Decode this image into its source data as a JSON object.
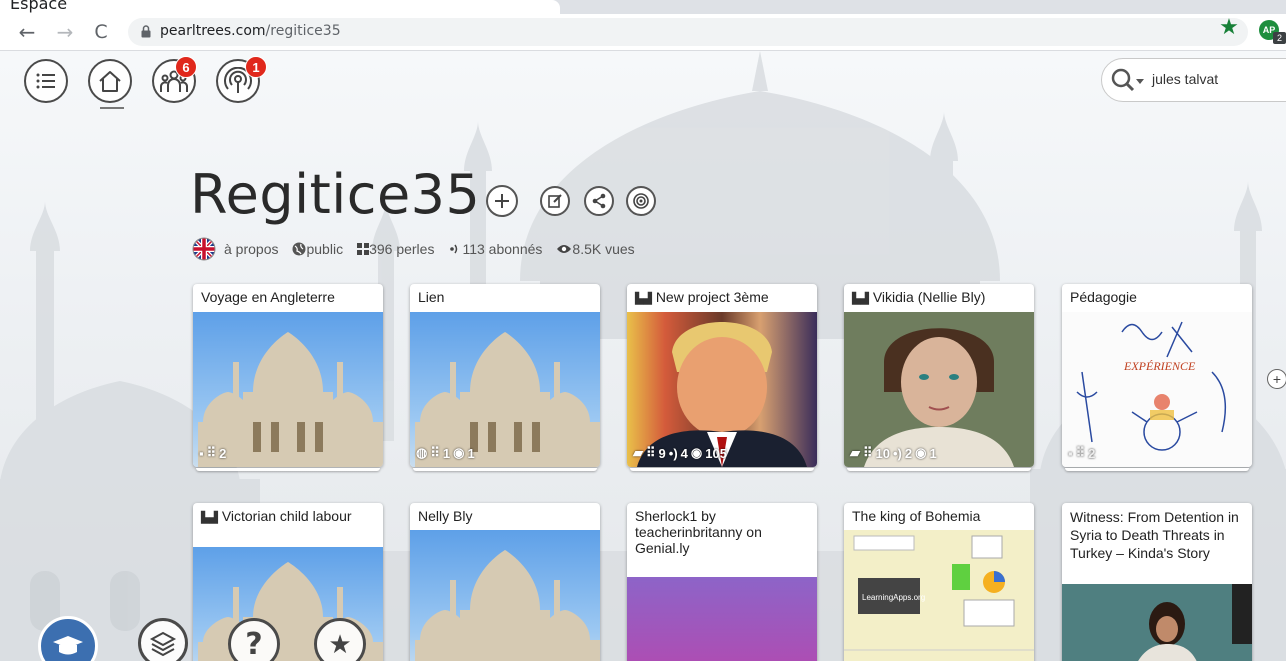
{
  "browser": {
    "tab_title": "Espace",
    "url_domain": "pearltrees.com",
    "url_path": "/regitice35",
    "profile_initials": "AP",
    "profile_extra": "2"
  },
  "nav": {
    "friends_badge": "6",
    "notifications_badge": "1"
  },
  "search": {
    "value": "jules talvat"
  },
  "profile": {
    "title": "Regitice35",
    "about": "à propos",
    "visibility": "public",
    "pearls": "396 perles",
    "followers": "113 abonnés",
    "views": "8.5K vues"
  },
  "cards": [
    {
      "title": "Voyage en Angleterre",
      "team": false,
      "stats": [
        "2"
      ],
      "image": "palace"
    },
    {
      "title": "Lien",
      "team": false,
      "stats": [
        "1",
        "1"
      ],
      "image": "palace"
    },
    {
      "title": "New project 3ème",
      "team": true,
      "stats": [
        "9",
        "4",
        "105"
      ],
      "image": "portrait-man"
    },
    {
      "title": "Vikidia (Nellie Bly)",
      "team": true,
      "stats": [
        "10",
        "2",
        "1"
      ],
      "image": "portrait-woman"
    },
    {
      "title": "Pédagogie",
      "team": false,
      "stats": [
        "2"
      ],
      "image": "sketch",
      "image_text": "EXPÉRIENCE"
    },
    {
      "title": "Victorian child labour",
      "team": true,
      "image": "palace"
    },
    {
      "title": "Nelly Bly",
      "team": false,
      "image": "palace"
    },
    {
      "title": "Sherlock1 by teacherinbritanny on Genial.ly",
      "team": false,
      "image": "gradient"
    },
    {
      "title": "The king of Bohemia",
      "team": false,
      "image": "learningapps",
      "image_text": "LearningApps.org"
    },
    {
      "title": "Witness: From Detention in Syria to Death Threats in Turkey – Kinda's Story",
      "team": false,
      "image": "photo"
    }
  ],
  "colors": {
    "badge": "#e0281c",
    "star": "#188038",
    "profile": "#1e8e3e"
  }
}
